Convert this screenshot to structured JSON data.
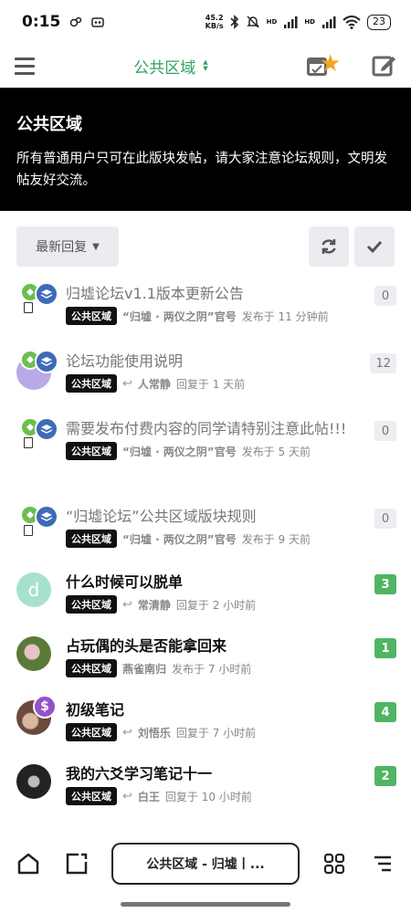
{
  "status_bar": {
    "time": "0:15",
    "net_speed_value": "45.2",
    "net_speed_unit": "KB/s",
    "signal_1": "HD",
    "signal_2": "HD",
    "battery": "23"
  },
  "nav": {
    "title": "公共区域"
  },
  "banner": {
    "title": "公共区域",
    "description": "所有普通用户只可在此版块发帖，请大家注意论坛规则，文明发帖友好交流。"
  },
  "toolbar": {
    "sort_label": "最新回复"
  },
  "topics": [
    {
      "title": "归墟论坛v1.1版本更新公告",
      "category": "公共区域",
      "poster": "“归墟 · 两仪之阴”官号",
      "action": "发布于 11 分钟前",
      "count": "0"
    },
    {
      "title": "论坛功能使用说明",
      "category": "公共区域",
      "poster": "人常静",
      "action": "回复于 1 天前",
      "count": "12"
    },
    {
      "title": "需要发布付费内容的同学请特别注意此帖!!!",
      "category": "公共区域",
      "poster": "“归墟 · 两仪之阴”官号",
      "action": "发布于 5 天前",
      "count": "0"
    },
    {
      "title": "“归墟论坛”公共区域版块规则",
      "category": "公共区域",
      "poster": "“归墟 · 两仪之阴”官号",
      "action": "发布于 9 天前",
      "count": "0"
    },
    {
      "title": "什么时候可以脱单",
      "category": "公共区域",
      "poster": "常清静",
      "action": "回复于 2 小时前",
      "count": "3",
      "avatar_letter": "d"
    },
    {
      "title": "占玩偶的头是否能拿回来",
      "category": "公共区域",
      "poster": "燕雀南归",
      "action": "发布于 7 小时前",
      "count": "1"
    },
    {
      "title": "初级笔记",
      "category": "公共区域",
      "poster": "刘悟乐",
      "action": "回复于 7 小时前",
      "count": "4"
    },
    {
      "title": "我的六爻学习笔记十一",
      "category": "公共区域",
      "poster": "白王",
      "action": "回复于 10 小时前",
      "count": "2"
    }
  ],
  "bottom_bar": {
    "pill_label": "公共区域 - 归墟丨..."
  },
  "colors": {
    "accent_green": "#2fa35f",
    "unread_badge": "#4fb564",
    "banner_bg": "#000000"
  }
}
